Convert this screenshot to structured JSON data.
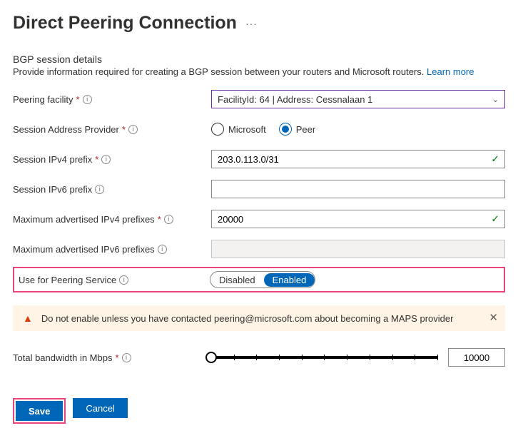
{
  "title": "Direct Peering Connection",
  "section": {
    "heading": "BGP session details",
    "sub": "Provide information required for creating a BGP session between your routers and Microsoft routers.",
    "learnMore": "Learn more"
  },
  "labels": {
    "facility": "Peering facility",
    "sap": "Session Address Provider",
    "ipv4prefix": "Session IPv4 prefix",
    "ipv6prefix": "Session IPv6 prefix",
    "maxIpv4": "Maximum advertised IPv4 prefixes",
    "maxIpv6": "Maximum advertised IPv6 prefixes",
    "useForPeering": "Use for Peering Service",
    "bandwidth": "Total bandwidth in Mbps"
  },
  "values": {
    "facility": "FacilityId: 64 | Address: Cessnalaan 1",
    "sapSelected": "Peer",
    "ipv4prefix": "203.0.113.0/31",
    "ipv6prefix": "",
    "maxIpv4": "20000",
    "maxIpv6": "",
    "useForPeering": "Enabled",
    "bandwidth": "10000"
  },
  "radios": {
    "microsoft": "Microsoft",
    "peer": "Peer"
  },
  "toggle": {
    "off": "Disabled",
    "on": "Enabled"
  },
  "alert": "Do not enable unless you have contacted peering@microsoft.com about becoming a MAPS provider",
  "buttons": {
    "save": "Save",
    "cancel": "Cancel"
  }
}
